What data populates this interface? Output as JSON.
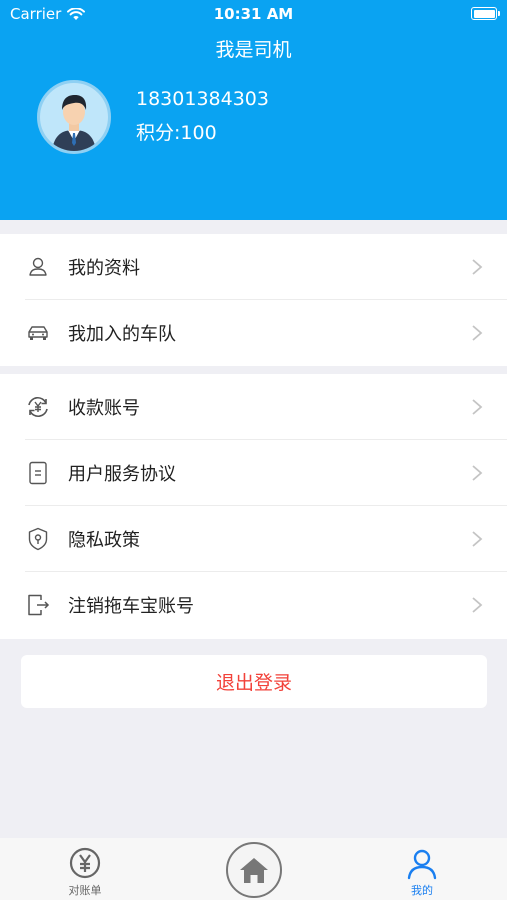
{
  "status_bar": {
    "carrier": "Carrier",
    "time": "10:31 AM"
  },
  "header": {
    "title": "我是司机",
    "phone": "18301384303",
    "points": "积分:100"
  },
  "menu_group1": [
    {
      "label": "我的资料",
      "icon": "user-icon"
    },
    {
      "label": "我加入的车队",
      "icon": "car-icon"
    }
  ],
  "menu_group2": [
    {
      "label": "收款账号",
      "icon": "yuan-exchange-icon"
    },
    {
      "label": "用户服务协议",
      "icon": "document-icon"
    },
    {
      "label": "隐私政策",
      "icon": "shield-icon"
    },
    {
      "label": "注销拖车宝账号",
      "icon": "exit-icon"
    }
  ],
  "logout": {
    "label": "退出登录",
    "color": "#f2423a"
  },
  "tabbar": {
    "tabs": [
      {
        "label": "对账单",
        "icon": "yuan-circle-icon"
      },
      {
        "label": "",
        "icon": "home-icon"
      },
      {
        "label": "我的",
        "icon": "person-icon"
      }
    ],
    "active_color": "#1a7ff0"
  },
  "colors": {
    "header_bg": "#0aa3f2",
    "page_bg": "#efeff4"
  }
}
